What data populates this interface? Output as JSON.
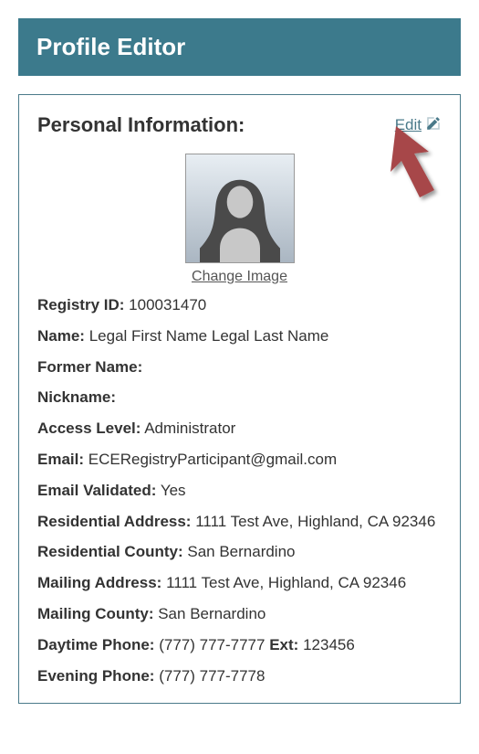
{
  "header": {
    "title": "Profile Editor"
  },
  "section": {
    "title": "Personal Information:",
    "edit_label": "Edit",
    "change_image_label": "Change Image"
  },
  "fields": {
    "registry_id": {
      "label": "Registry ID:",
      "value": "100031470"
    },
    "name": {
      "label": "Name:",
      "value": "Legal First Name Legal Last Name"
    },
    "former_name": {
      "label": "Former Name:",
      "value": ""
    },
    "nickname": {
      "label": "Nickname:",
      "value": ""
    },
    "access_level": {
      "label": "Access Level:",
      "value": "Administrator"
    },
    "email": {
      "label": "Email:",
      "value": "ECERegistryParticipant@gmail.com"
    },
    "email_validated": {
      "label": "Email Validated:",
      "value": "Yes"
    },
    "res_address": {
      "label": "Residential Address:",
      "value": "1111 Test Ave, Highland, CA 92346"
    },
    "res_county": {
      "label": "Residential County:",
      "value": "San Bernardino"
    },
    "mail_address": {
      "label": "Mailing Address:",
      "value": "1111 Test Ave, Highland, CA 92346"
    },
    "mail_county": {
      "label": "Mailing County:",
      "value": "San Bernardino"
    },
    "day_phone": {
      "label": "Daytime Phone:",
      "value": "(777) 777-7777",
      "ext_label": "Ext:",
      "ext_value": "123456"
    },
    "eve_phone": {
      "label": "Evening Phone:",
      "value": "(777) 777-7778"
    }
  }
}
